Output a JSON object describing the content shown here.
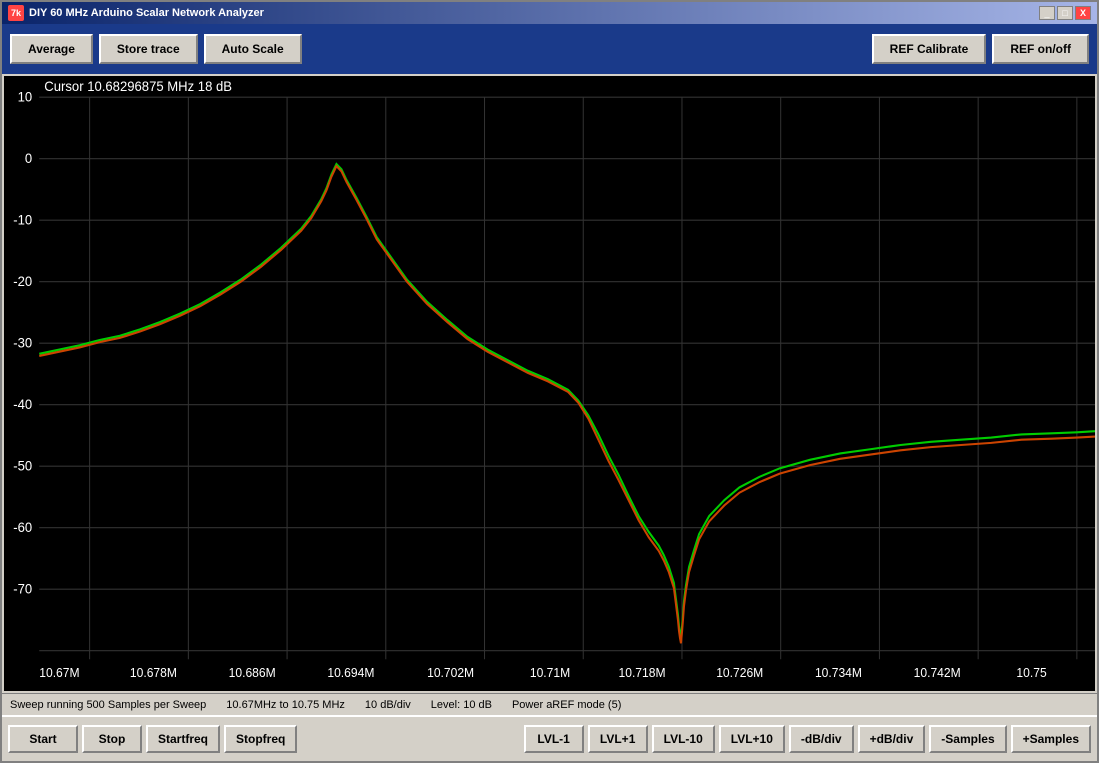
{
  "window": {
    "title": "DIY 60 MHz Arduino Scalar Network Analyzer",
    "icon": "7k"
  },
  "title_controls": {
    "minimize": "_",
    "maximize": "□",
    "close": "X"
  },
  "toolbar": {
    "average_label": "Average",
    "store_trace_label": "Store trace",
    "auto_scale_label": "Auto Scale",
    "ref_calibrate_label": "REF Calibrate",
    "ref_onoff_label": "REF on/off"
  },
  "chart": {
    "cursor_label": "Cursor",
    "cursor_freq": "10.68296875 MHz",
    "cursor_db": "18 dB",
    "y_labels": [
      "10",
      "0",
      "-10",
      "-20",
      "-30",
      "-40",
      "-50",
      "-60",
      "-70"
    ],
    "x_labels": [
      "10.67M",
      "10.678M",
      "10.686M",
      "10.694M",
      "10.702M",
      "10.71M",
      "10.718M",
      "10.726M",
      "10.734M",
      "10.742M",
      "10.75"
    ]
  },
  "status_bar": {
    "sweep_text": "Sweep running 500 Samples per Sweep",
    "freq_range": "10.67MHz to 10.75 MHz",
    "db_div": "10 dB/div",
    "level": "Level: 10 dB",
    "power_text": "Power aREF mode (5)"
  },
  "bottom_toolbar": {
    "start_label": "Start",
    "stop_label": "Stop",
    "startfreq_label": "Startfreq",
    "stopfreq_label": "Stopfreq",
    "lvl_minus1_label": "LVL-1",
    "lvl_plus1_label": "LVL+1",
    "lvl_minus10_label": "LVL-10",
    "lvl_plus10_label": "LVL+10",
    "db_minus_label": "-dB/div",
    "db_plus_label": "+dB/div",
    "samples_minus_label": "-Samples",
    "samples_plus_label": "+Samples"
  },
  "colors": {
    "toolbar_bg": "#1a3a8a",
    "chart_bg": "#000000",
    "grid_color": "#333333",
    "trace_green": "#00ff00",
    "trace_red": "#ff4400",
    "text_color": "#ffffff",
    "window_bg": "#d4d0c8"
  }
}
